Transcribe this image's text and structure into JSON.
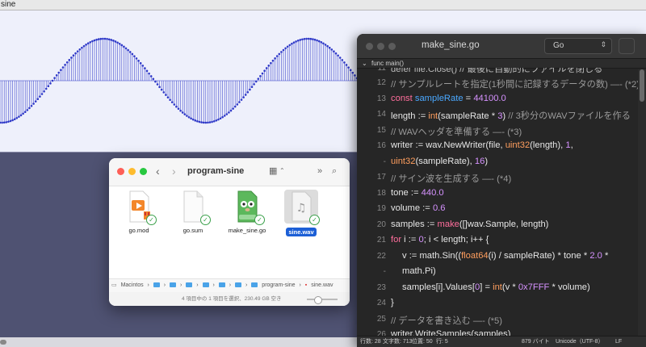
{
  "audio": {
    "title": "sine"
  },
  "finder": {
    "title": "program-sine",
    "files": [
      {
        "name": "go.mod",
        "selected": false
      },
      {
        "name": "go.sum",
        "selected": false
      },
      {
        "name": "make_sine.go",
        "selected": false
      },
      {
        "name": "sine.wav",
        "selected": true
      }
    ],
    "path": {
      "root": "Macintos",
      "folder": "program-sine",
      "file": "sine.wav"
    },
    "status": "4 項目中の 1 項目を選択、230.49 GB 空き"
  },
  "editor": {
    "title": "make_sine.go",
    "language": "Go",
    "function_nav": "func main()",
    "lines": [
      {
        "no": "12",
        "text": "// サンプルレートを指定(1秒間に記録するデータの数) —- (*2)"
      },
      {
        "no": "13",
        "text": "const sampleRate = 44100.0"
      },
      {
        "no": "14",
        "text": "length := int(sampleRate * 3) // 3秒分のWAVファイルを作る"
      },
      {
        "no": "15",
        "text": "// WAVヘッダを準備する —- (*3)"
      },
      {
        "no": "16",
        "text": "writer := wav.NewWriter(file, uint32(length), 1,"
      },
      {
        "no": "-",
        "text": "uint32(sampleRate), 16)"
      },
      {
        "no": "17",
        "text": "// サイン波を生成する —- (*4)"
      },
      {
        "no": "18",
        "text": "tone := 440.0"
      },
      {
        "no": "19",
        "text": "volume := 0.6"
      },
      {
        "no": "20",
        "text": "samples := make([]wav.Sample, length)"
      },
      {
        "no": "21",
        "text": "for i := 0; i < length; i++ {"
      },
      {
        "no": "22",
        "text": "v := math.Sin((float64(i) / sampleRate) * tone * 2.0 *"
      },
      {
        "no": "-",
        "text": "math.Pi)"
      },
      {
        "no": "23",
        "text": "samples[i].Values[0] = int(v * 0x7FFF * volume)"
      },
      {
        "no": "24",
        "text": "}"
      },
      {
        "no": "25",
        "text": "// データを書き込む —- (*5)"
      },
      {
        "no": "26",
        "text": "writer.WriteSamples(samples)"
      }
    ],
    "status": {
      "lines": "行数: 28",
      "chars": "文字数: 713",
      "position": "位置: 50",
      "row": "行: 5",
      "size": "879 バイト",
      "encoding": "Unicode（UTF-8）",
      "line_ending": "LF"
    }
  },
  "colors": {
    "waveform": "#2f39c8",
    "waveform_bg": "#eef0fb",
    "editor_bg": "#262626",
    "keyword": "#ff6e9c",
    "type": "#ff9e5e",
    "number": "#d692ff",
    "const": "#4aa8ff",
    "selection": "#1c5fd6"
  }
}
